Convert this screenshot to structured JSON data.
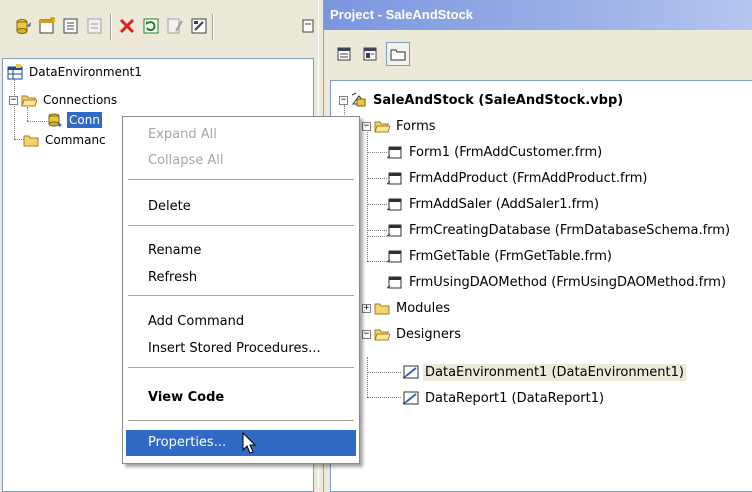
{
  "data_environment": {
    "toolbar_icons": [
      "add-connection-icon",
      "add-command-icon",
      "insert-stored-procedures-icon",
      "add-child-command-icon",
      "delete-icon",
      "refresh-icon",
      "design-icon",
      "properties-icon",
      "view-code-icon"
    ],
    "tree": {
      "root": "DataEnvironment1",
      "connections_folder": "Connections",
      "connection_item": "Conn",
      "commands_folder": "Commanc"
    }
  },
  "context_menu": {
    "items": [
      {
        "label": "Expand All",
        "state": "disabled"
      },
      {
        "label": "Collapse All",
        "state": "disabled"
      },
      {
        "label": "Delete",
        "state": "enabled"
      },
      {
        "label": "Rename",
        "state": "enabled"
      },
      {
        "label": "Refresh",
        "state": "enabled"
      },
      {
        "label": "Add Command",
        "state": "enabled"
      },
      {
        "label": "Insert Stored Procedures...",
        "state": "enabled"
      },
      {
        "label": "View Code",
        "state": "bold"
      },
      {
        "label": "Properties...",
        "state": "highlighted"
      }
    ]
  },
  "project_explorer": {
    "title": "Project - SaleAndStock",
    "toolbar_icons": [
      "view-code-icon",
      "view-object-icon",
      "toggle-folders-icon"
    ],
    "root": "SaleAndStock (SaleAndStock.vbp)",
    "forms_folder": "Forms",
    "forms": [
      "Form1 (FrmAddCustomer.frm)",
      "FrmAddProduct (FrmAddProduct.frm)",
      "FrmAddSaler (AddSaler1.frm)",
      "FrmCreatingDatabase (FrmDatabaseSchema.frm)",
      "FrmGetTable (FrmGetTable.frm)",
      "FrmUsingDAOMethod (FrmUsingDAOMethod.frm)"
    ],
    "modules_folder": "Modules",
    "designers_folder": "Designers",
    "designers": [
      "DataEnvironment1 (DataEnvironment1)",
      "DataReport1 (DataReport1)"
    ]
  },
  "colors": {
    "selection": "#316ac5",
    "titlebar": "#7a96df",
    "window_bg": "#ece9d8",
    "disabled_text": "#a6a6a6"
  }
}
